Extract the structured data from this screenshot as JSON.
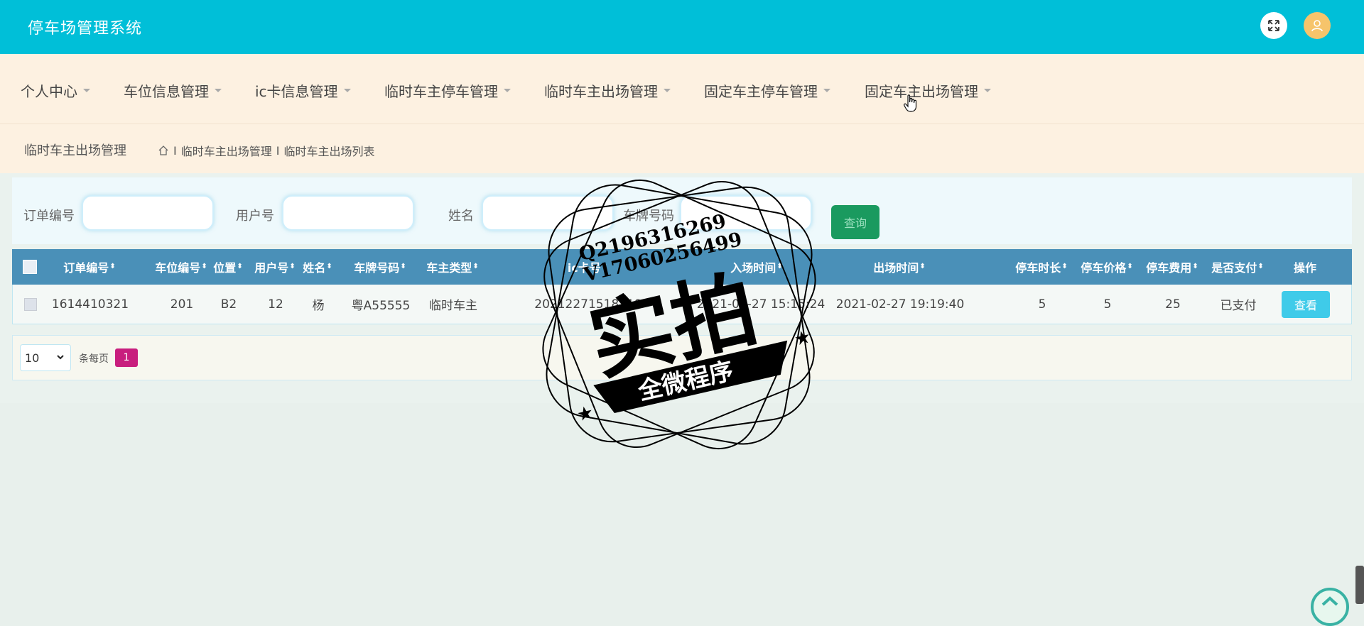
{
  "app": {
    "title": "停车场管理系统"
  },
  "header": {
    "fullscreen_icon": "expand-arrows-icon",
    "avatar_icon": "user-icon",
    "avatar_color": "#f6c46b"
  },
  "nav": {
    "items": [
      {
        "label": "个人中心"
      },
      {
        "label": "车位信息管理"
      },
      {
        "label": "ic卡信息管理"
      },
      {
        "label": "临时车主停车管理"
      },
      {
        "label": "临时车主出场管理"
      },
      {
        "label": "固定车主停车管理"
      },
      {
        "label": "固定车主出场管理"
      }
    ]
  },
  "breadcrumb": {
    "title": "临时车主出场管理",
    "sep1": "I",
    "path1": "临时车主出场管理",
    "sep2": "I",
    "path2": "临时车主出场列表"
  },
  "search": {
    "order_label": "订单编号",
    "user_label": "用户号",
    "name_label": "姓名",
    "plate_label": "车牌号码",
    "button_label": "查询"
  },
  "table": {
    "headers": [
      "订单编号",
      "车位编号",
      "位置",
      "用户号",
      "姓名",
      "车牌号码",
      "车主类型",
      "ic卡号",
      "入场时间",
      "出场时间",
      "停车时长",
      "停车价格",
      "停车费用",
      "是否支付",
      "操作"
    ],
    "rows": [
      {
        "order_no": "1614410321",
        "space_no": "201",
        "location": "B2",
        "user_no": "12",
        "name": "杨",
        "plate": "粤A55555",
        "owner_type": "临时车主",
        "ic_card": "20212271518119",
        "entry_time": "2021-02-27 15:15:24",
        "exit_time": "2021-02-27 19:19:40",
        "duration": "5",
        "price": "5",
        "fee": "25",
        "paid": "已支付",
        "action": "查看"
      }
    ]
  },
  "pager": {
    "page_size": "10",
    "per_page_label": "条每页",
    "current_page": "1"
  },
  "watermark": {
    "line1": "Q2196316269",
    "line2": "V17060256499",
    "main": "实拍",
    "banner": "全微程序"
  },
  "colors": {
    "topbar": "#00bfd8",
    "nav_bg": "#fdf1e1",
    "table_header": "#4a90b8",
    "search_button": "#1a9a5f",
    "view_button": "#3fcbe9",
    "page_active": "#c81e7e"
  }
}
